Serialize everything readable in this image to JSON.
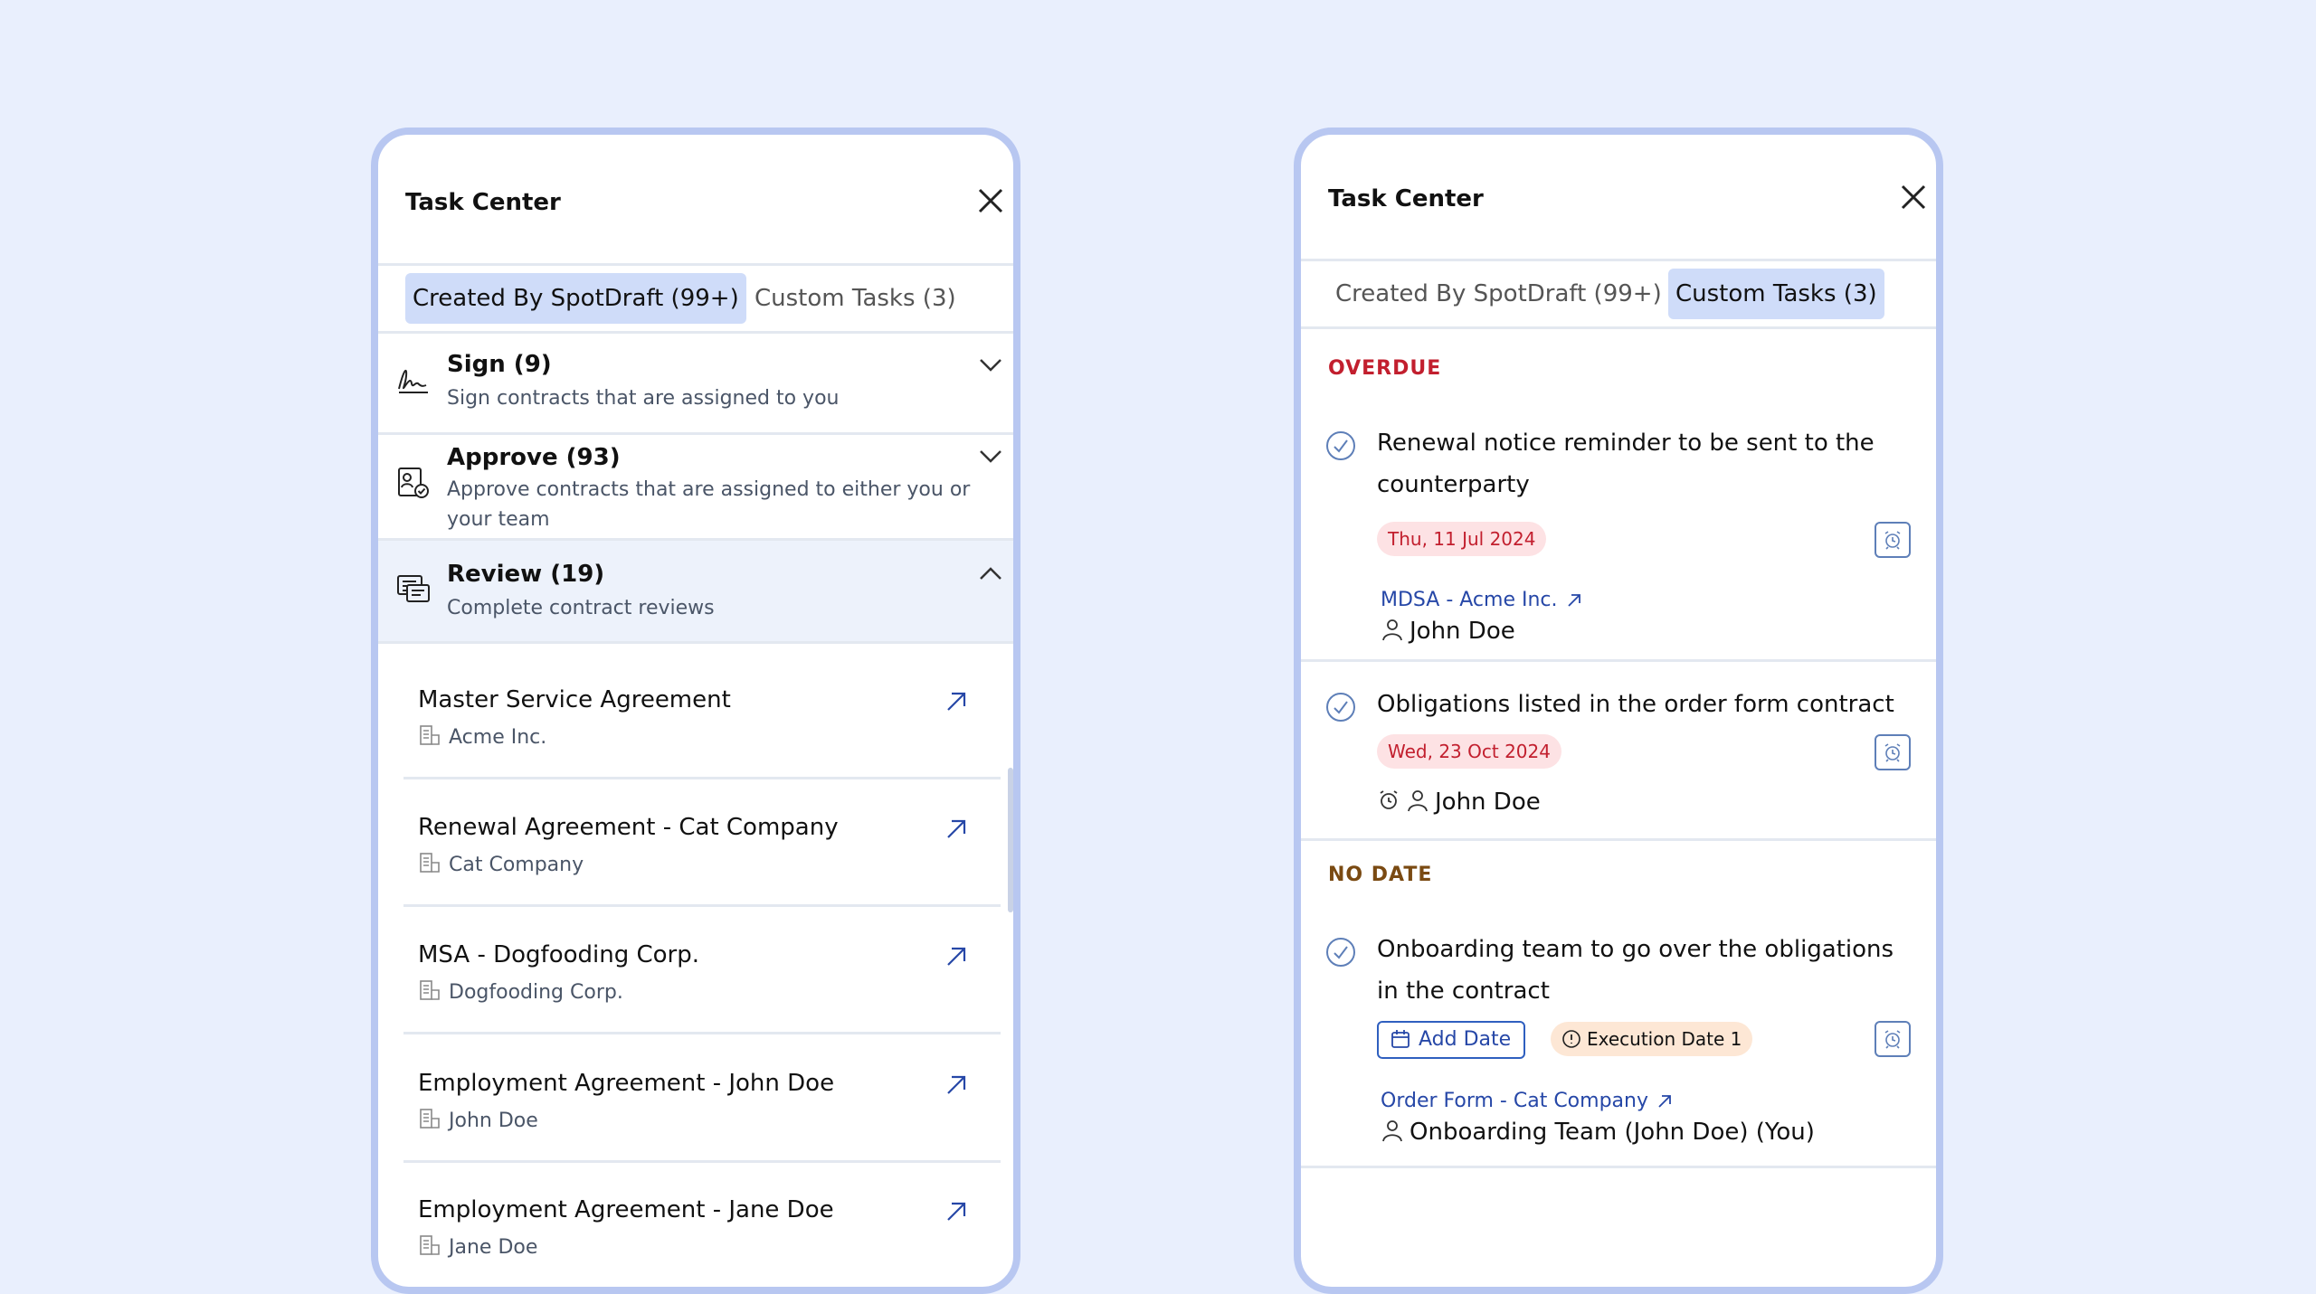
{
  "left_panel": {
    "title": "Task Center",
    "tabs": [
      {
        "label": "Created By SpotDraft (99+)",
        "active": true
      },
      {
        "label": "Custom Tasks (3)",
        "active": false
      }
    ],
    "sections": [
      {
        "title": "Sign  (9)",
        "description": "Sign contracts that are assigned to you",
        "icon": "signature-icon",
        "expanded": false
      },
      {
        "title": "Approve  (93)",
        "description": "Approve contracts that are assigned to either you or your team",
        "icon": "approve-icon",
        "expanded": false
      },
      {
        "title": "Review  (19)",
        "description": "Complete contract reviews",
        "icon": "review-icon",
        "expanded": true
      }
    ],
    "review_items": [
      {
        "name": "Master Service Agreement",
        "org": "Acme Inc."
      },
      {
        "name": "Renewal Agreement - Cat Company",
        "org": "Cat Company"
      },
      {
        "name": "MSA - Dogfooding Corp.",
        "org": "Dogfooding Corp."
      },
      {
        "name": "Employment Agreement - John Doe",
        "org": "John Doe"
      },
      {
        "name": "Employment Agreement - Jane Doe",
        "org": "Jane Doe"
      }
    ]
  },
  "right_panel": {
    "title": "Task Center",
    "tabs": [
      {
        "label": "Created By SpotDraft (99+)",
        "active": false
      },
      {
        "label": "Custom Tasks (3)",
        "active": true
      }
    ],
    "groups": {
      "overdue": {
        "label": "OVERDUE",
        "color": "#c21f2e"
      },
      "no_date": {
        "label": "NO DATE",
        "color": "#7a4a12"
      }
    },
    "tasks": [
      {
        "title": "Renewal notice reminder to be sent to the counterparty",
        "date": "Thu, 11 Jul 2024",
        "contract": "MDSA - Acme Inc.",
        "assignee": "John Doe"
      },
      {
        "title": "Obligations listed in the order form contract",
        "date": "Wed, 23 Oct 2024",
        "assignee": "John Doe"
      },
      {
        "title": "Onboarding team to go over the obligations in the contract",
        "add_date_label": "Add Date",
        "execution_badge": "Execution Date 1",
        "contract": "Order Form - Cat Company",
        "assignee": "Onboarding Team (John Doe) (You)"
      }
    ]
  },
  "colors": {
    "background": "#e9effd",
    "panel_border": "#b8c7f1",
    "active_tab": "#cfdcf9",
    "link": "#2647a7"
  }
}
